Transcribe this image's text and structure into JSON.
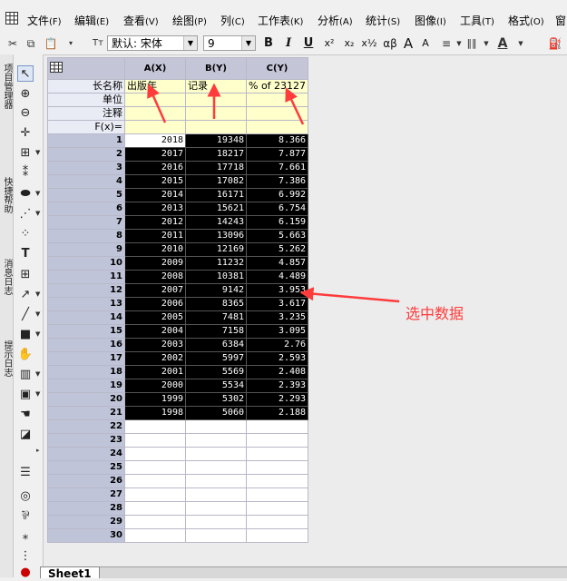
{
  "menu": [
    {
      "label": "文件",
      "acc": "(F)"
    },
    {
      "label": "编辑",
      "acc": "(E)"
    },
    {
      "label": "查看",
      "acc": "(V)"
    },
    {
      "label": "绘图",
      "acc": "(P)"
    },
    {
      "label": "列",
      "acc": "(C)"
    },
    {
      "label": "工作表",
      "acc": "(K)"
    },
    {
      "label": "分析",
      "acc": "(A)"
    },
    {
      "label": "统计",
      "acc": "(S)"
    },
    {
      "label": "图像",
      "acc": "(I)"
    },
    {
      "label": "工具",
      "acc": "(T)"
    },
    {
      "label": "格式",
      "acc": "(O)"
    },
    {
      "label": "窗",
      "acc": ""
    }
  ],
  "toolbar": {
    "font_name": "默认: 宋体",
    "font_size": "9",
    "bold": "B",
    "italic": "I",
    "underline": "U",
    "superscript": "x²",
    "subscript": "x₂",
    "supsub": "x½",
    "greek": "αβ",
    "grow": "A",
    "shrink": "A"
  },
  "left_tabs": [
    "项目管理器",
    "快捷帮助",
    "消息日志",
    "提示日志"
  ],
  "worksheet": {
    "corner_icon": "worksheet-icon",
    "columns": [
      "A(X)",
      "B(Y)",
      "C(Y)"
    ],
    "label_rows": [
      {
        "name": "长名称",
        "values": [
          "出版年",
          "记录",
          "% of 23127"
        ]
      },
      {
        "name": "单位",
        "values": [
          "",
          "",
          ""
        ]
      },
      {
        "name": "注释",
        "values": [
          "",
          "",
          ""
        ]
      },
      {
        "name": "F(x)=",
        "values": [
          "",
          "",
          ""
        ]
      }
    ],
    "rows": [
      [
        "1",
        "2018",
        "19348",
        "8.366"
      ],
      [
        "2",
        "2017",
        "18217",
        "7.877"
      ],
      [
        "3",
        "2016",
        "17718",
        "7.661"
      ],
      [
        "4",
        "2015",
        "17082",
        "7.386"
      ],
      [
        "5",
        "2014",
        "16171",
        "6.992"
      ],
      [
        "6",
        "2013",
        "15621",
        "6.754"
      ],
      [
        "7",
        "2012",
        "14243",
        "6.159"
      ],
      [
        "8",
        "2011",
        "13096",
        "5.663"
      ],
      [
        "9",
        "2010",
        "12169",
        "5.262"
      ],
      [
        "10",
        "2009",
        "11232",
        "4.857"
      ],
      [
        "11",
        "2008",
        "10381",
        "4.489"
      ],
      [
        "12",
        "2007",
        "9142",
        "3.953"
      ],
      [
        "13",
        "2006",
        "8365",
        "3.617"
      ],
      [
        "14",
        "2005",
        "7481",
        "3.235"
      ],
      [
        "15",
        "2004",
        "7158",
        "3.095"
      ],
      [
        "16",
        "2003",
        "6384",
        "2.76"
      ],
      [
        "17",
        "2002",
        "5997",
        "2.593"
      ],
      [
        "18",
        "2001",
        "5569",
        "2.408"
      ],
      [
        "19",
        "2000",
        "5534",
        "2.393"
      ],
      [
        "20",
        "1999",
        "5302",
        "2.293"
      ],
      [
        "21",
        "1998",
        "5060",
        "2.188"
      ],
      [
        "22",
        "",
        "",
        ""
      ],
      [
        "23",
        "",
        "",
        ""
      ],
      [
        "24",
        "",
        "",
        ""
      ],
      [
        "25",
        "",
        "",
        ""
      ],
      [
        "26",
        "",
        "",
        ""
      ],
      [
        "27",
        "",
        "",
        ""
      ],
      [
        "28",
        "",
        "",
        ""
      ],
      [
        "29",
        "",
        "",
        ""
      ],
      [
        "30",
        "",
        "",
        ""
      ]
    ]
  },
  "annotation": {
    "text": "选中数据",
    "color": "#ff3b3b"
  },
  "sheet_tab": "Sheet1"
}
